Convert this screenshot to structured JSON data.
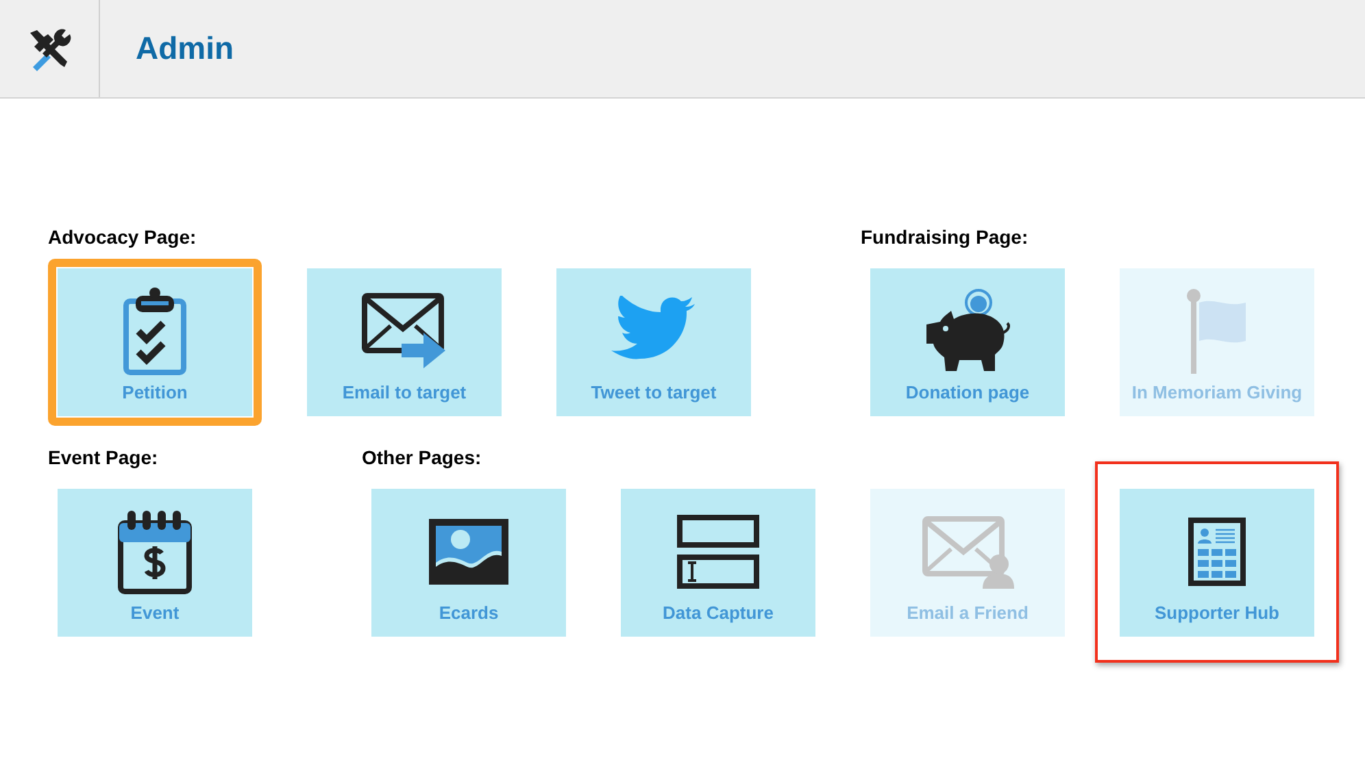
{
  "header": {
    "title": "Admin"
  },
  "rows": [
    {
      "sections": [
        {
          "heading": "Advocacy Page:",
          "tiles": [
            {
              "label": "Petition",
              "kind": "clipboard",
              "selected": true,
              "disabled": false,
              "highlighted": false
            },
            {
              "label": "Email to target",
              "kind": "email-arrow",
              "selected": false,
              "disabled": false,
              "highlighted": false
            },
            {
              "label": "Tweet to target",
              "kind": "bird",
              "selected": false,
              "disabled": false,
              "highlighted": false
            }
          ]
        },
        {
          "heading": "Fundraising Page:",
          "tiles": [
            {
              "label": "Donation page",
              "kind": "piggy",
              "selected": false,
              "disabled": false,
              "highlighted": false
            },
            {
              "label": "In Memoriam Giving",
              "kind": "flag",
              "selected": false,
              "disabled": true,
              "highlighted": false
            }
          ]
        }
      ]
    },
    {
      "sections": [
        {
          "heading": "Event Page:",
          "tiles": [
            {
              "label": "Event",
              "kind": "calendar",
              "selected": false,
              "disabled": false,
              "highlighted": false
            }
          ]
        },
        {
          "heading": "Other Pages:",
          "tiles": [
            {
              "label": "Ecards",
              "kind": "picture-frame",
              "selected": false,
              "disabled": false,
              "highlighted": false
            },
            {
              "label": "Data Capture",
              "kind": "form",
              "selected": false,
              "disabled": false,
              "highlighted": false
            },
            {
              "label": "Email a Friend",
              "kind": "email-person",
              "selected": false,
              "disabled": true,
              "highlighted": false
            },
            {
              "label": "Supporter Hub",
              "kind": "directory",
              "selected": false,
              "disabled": false,
              "highlighted": true
            }
          ]
        }
      ]
    }
  ]
}
